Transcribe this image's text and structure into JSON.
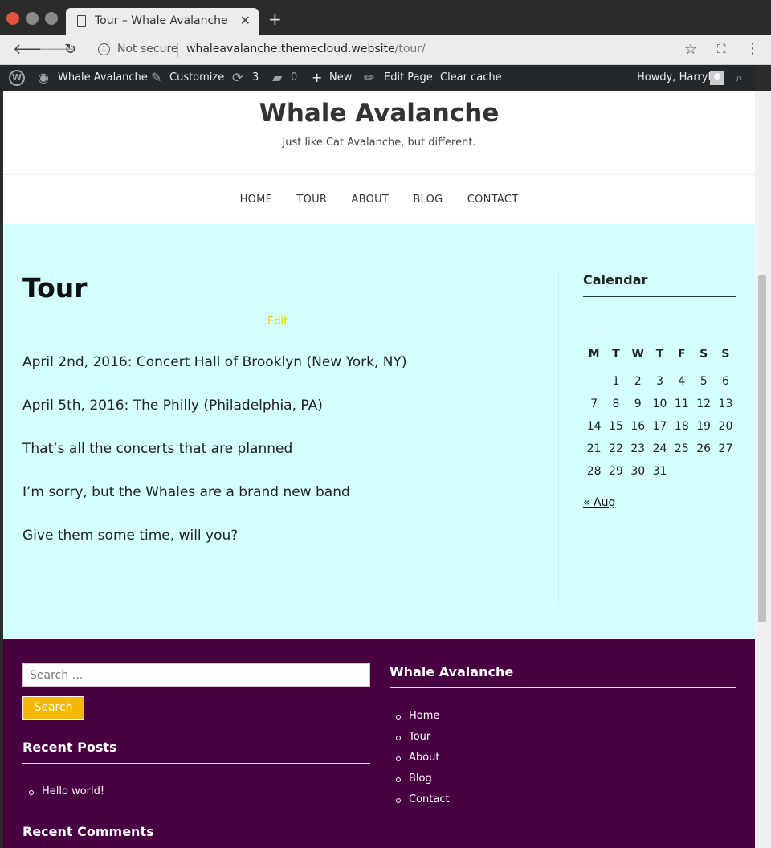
{
  "browser": {
    "tab_title": "Tour – Whale Avalanche",
    "security_text": "Not secure",
    "url_host": "whaleavalanche.themecloud.website",
    "url_path": "/tour/"
  },
  "admin_bar": {
    "site_name": "Whale Avalanche",
    "customize": "Customize",
    "updates_count": "3",
    "comments_count": "0",
    "new_label": "New",
    "edit_page": "Edit Page",
    "clear_cache": "Clear cache",
    "howdy": "Howdy, HarryR"
  },
  "site": {
    "title": "Whale Avalanche",
    "description": "Just like Cat Avalanche, but different."
  },
  "nav": [
    "HOME",
    "TOUR",
    "ABOUT",
    "BLOG",
    "CONTACT"
  ],
  "page": {
    "title": "Tour",
    "edit_label": "Edit",
    "lines": [
      "April 2nd, 2016: Concert Hall of Brooklyn (New York, NY)",
      "April 5th, 2016: The Philly (Philadelphia, PA)",
      "That’s all the concerts that are planned",
      "I’m sorry, but the Whales are a brand new band",
      "Give them some time, will you?"
    ]
  },
  "calendar": {
    "heading": "Calendar",
    "caption": "October 2018",
    "weekdays": [
      "M",
      "T",
      "W",
      "T",
      "F",
      "S",
      "S"
    ],
    "weeks": [
      [
        "",
        "1",
        "2",
        "3",
        "4",
        "5",
        "6"
      ],
      [
        "7",
        "8",
        "9",
        "10",
        "11",
        "12",
        "13"
      ],
      [
        "14",
        "15",
        "16",
        "17",
        "18",
        "19",
        "20"
      ],
      [
        "21",
        "22",
        "23",
        "24",
        "25",
        "26",
        "27"
      ],
      [
        "28",
        "29",
        "30",
        "31",
        "",
        "",
        ""
      ]
    ],
    "prev_link": "« Aug"
  },
  "footer": {
    "search_placeholder": "Search …",
    "search_button": "Search",
    "recent_posts_title": "Recent Posts",
    "recent_posts": [
      "Hello world!"
    ],
    "recent_comments_title": "Recent Comments",
    "menu_title": "Whale Avalanche",
    "menu_items": [
      "Home",
      "Tour",
      "About",
      "Blog",
      "Contact"
    ]
  },
  "colors": {
    "content_bg": "#d4ffff",
    "footer_bg": "#480043",
    "accent": "#f5b800",
    "admin_bar_bg": "#23282d"
  }
}
